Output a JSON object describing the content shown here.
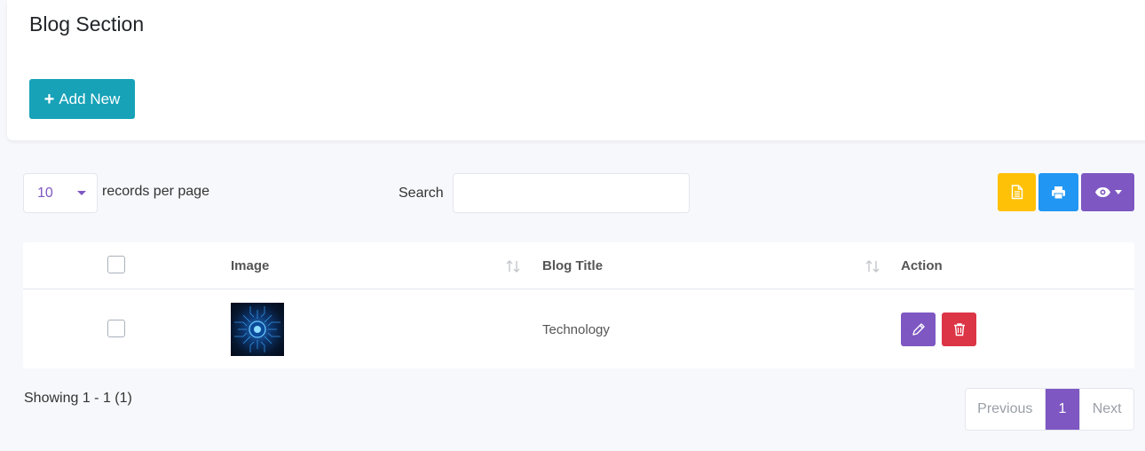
{
  "header": {
    "title": "Blog Section",
    "add_button_label": "Add New"
  },
  "toolbar": {
    "per_page_value": "10",
    "per_page_label": "records per page",
    "search_label": "Search",
    "search_value": "",
    "buttons": [
      "document-icon",
      "print-icon",
      "eye-icon"
    ]
  },
  "table": {
    "columns": [
      "",
      "Image",
      "Blog Title",
      "Action"
    ],
    "rows": [
      {
        "image": "technology-thumbnail",
        "title": "Technology"
      }
    ]
  },
  "footer": {
    "showing": "Showing 1 - 1 (1)",
    "prev_label": "Previous",
    "page": "1",
    "next_label": "Next"
  },
  "colors": {
    "accent": "#7e57c2",
    "add_button": "#17a2b8",
    "doc_button": "#ffc107",
    "print_button": "#2196f3",
    "delete_button": "#dc3545"
  }
}
